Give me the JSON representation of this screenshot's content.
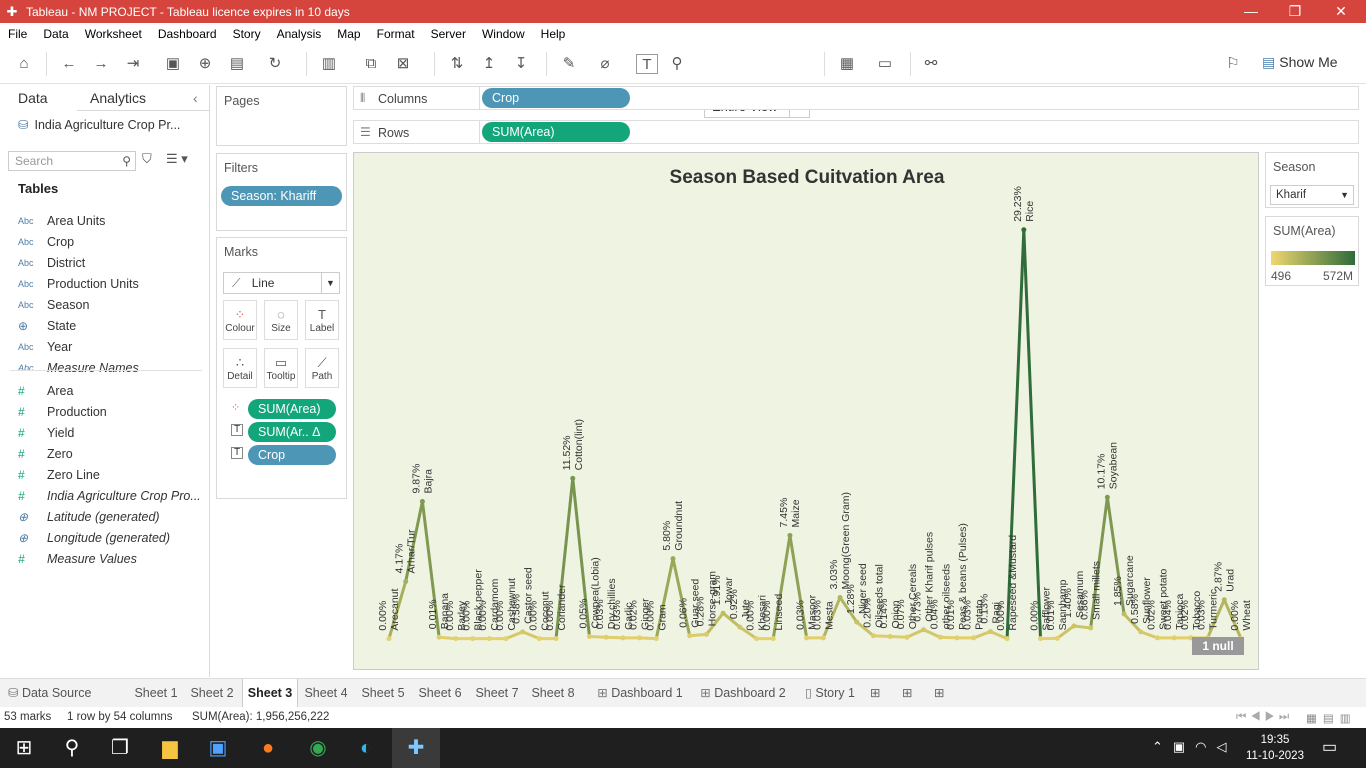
{
  "window": {
    "title": "Tableau - NM PROJECT - Tableau licence expires in 10 days"
  },
  "menu": [
    "File",
    "Data",
    "Worksheet",
    "Dashboard",
    "Story",
    "Analysis",
    "Map",
    "Format",
    "Server",
    "Window",
    "Help"
  ],
  "toolbar": {
    "fit": "Entire View",
    "show_me": "Show Me"
  },
  "left": {
    "tab_data": "Data",
    "tab_analytics": "Analytics",
    "datasource": "India Agriculture Crop Pr...",
    "search_placeholder": "Search",
    "tables_heading": "Tables",
    "fields": [
      {
        "type": "Abc",
        "name": "Area Units"
      },
      {
        "type": "Abc",
        "name": "Crop"
      },
      {
        "type": "Abc",
        "name": "District"
      },
      {
        "type": "Abc",
        "name": "Production Units"
      },
      {
        "type": "Abc",
        "name": "Season"
      },
      {
        "type": "geo",
        "name": "State"
      },
      {
        "type": "Abc",
        "name": "Year"
      },
      {
        "type": "Abc",
        "name": "Measure Names"
      },
      {
        "type": "#",
        "name": "Area"
      },
      {
        "type": "#",
        "name": "Production"
      },
      {
        "type": "#",
        "name": "Yield"
      },
      {
        "type": "#",
        "name": "Zero"
      },
      {
        "type": "#",
        "name": "Zero Line"
      },
      {
        "type": "#",
        "name": "India Agriculture Crop Pro..."
      },
      {
        "type": "geo",
        "name": "Latitude (generated)"
      },
      {
        "type": "geo",
        "name": "Longitude (generated)"
      },
      {
        "type": "#",
        "name": "Measure Values"
      }
    ]
  },
  "cards": {
    "pages": "Pages",
    "filters": "Filters",
    "filter_pill": "Season: Khariff",
    "marks": "Marks",
    "mark_type": "Line",
    "mark_buttons": [
      "Colour",
      "Size",
      "Label",
      "Detail",
      "Tooltip",
      "Path"
    ],
    "mark_pills": [
      "SUM(Area)",
      "SUM(Ar.. Δ",
      "Crop"
    ]
  },
  "shelves": {
    "columns_label": "Columns",
    "columns_pill": "Crop",
    "rows_label": "Rows",
    "rows_pill": "SUM(Area)"
  },
  "legend": {
    "season_title": "Season",
    "season_value": "Kharif",
    "color_title": "SUM(Area)",
    "min": "496",
    "max": "572M",
    "color_low": "#f0d770",
    "color_high": "#2e6b3a"
  },
  "null_badge": "1 null",
  "chart_data": {
    "type": "line",
    "title": "Season Based Cuitvation Area",
    "xlabel": "",
    "ylabel": "",
    "ylim": [
      0,
      30
    ],
    "grid": false,
    "points": [
      {
        "crop": "Arecanut",
        "pct": "0.00%",
        "v": 0.1
      },
      {
        "crop": "Arhar/Tur",
        "pct": "4.17%",
        "v": 4.17
      },
      {
        "crop": "Bajra",
        "pct": "9.87%",
        "v": 9.87
      },
      {
        "crop": "Banana",
        "pct": "0.01%",
        "v": 0.2
      },
      {
        "crop": "Barley",
        "pct": "0.00%",
        "v": 0.1
      },
      {
        "crop": "Black pepper",
        "pct": "0.00%",
        "v": 0.1
      },
      {
        "crop": "Cardamom",
        "pct": "0.00%",
        "v": 0.1
      },
      {
        "crop": "Cashewnut",
        "pct": "0.00%",
        "v": 0.1
      },
      {
        "crop": "Castor seed",
        "pct": "0.58%",
        "v": 0.58
      },
      {
        "crop": "Coconut",
        "pct": "0.00%",
        "v": 0.1
      },
      {
        "crop": "Coriander",
        "pct": "0.00%",
        "v": 0.1
      },
      {
        "crop": "Cotton(lint)",
        "pct": "11.52%",
        "v": 11.52
      },
      {
        "crop": "Cowpea(Lobia)",
        "pct": "0.05%",
        "v": 0.25
      },
      {
        "crop": "Dry chillies",
        "pct": "0.03%",
        "v": 0.2
      },
      {
        "crop": "Garlic",
        "pct": "0.03%",
        "v": 0.15
      },
      {
        "crop": "Ginger",
        "pct": "0.02%",
        "v": 0.15
      },
      {
        "crop": "Gram",
        "pct": "0.00%",
        "v": 0.1
      },
      {
        "crop": "Groundnut",
        "pct": "5.80%",
        "v": 5.8
      },
      {
        "crop": "Guar seed",
        "pct": "0.06%",
        "v": 0.3
      },
      {
        "crop": "Horse-gram",
        "pct": "0.28%",
        "v": 0.4
      },
      {
        "crop": "Jowar",
        "pct": "1.91%",
        "v": 1.91
      },
      {
        "crop": "Jute",
        "pct": "0.92%",
        "v": 0.92
      },
      {
        "crop": "Khesari",
        "pct": "0.00%",
        "v": 0.1
      },
      {
        "crop": "Linseed",
        "pct": "0.00%",
        "v": 0.1
      },
      {
        "crop": "Maize",
        "pct": "7.45%",
        "v": 7.45
      },
      {
        "crop": "Masoor",
        "pct": "0.03%",
        "v": 0.15
      },
      {
        "crop": "Mesta",
        "pct": "0.03%",
        "v": 0.15
      },
      {
        "crop": "Moong(Green Gram)",
        "pct": "3.03%",
        "v": 3.03
      },
      {
        "crop": "Niger seed",
        "pct": "1.28%",
        "v": 1.28
      },
      {
        "crop": "Oilseeds total",
        "pct": "0.20%",
        "v": 0.3
      },
      {
        "crop": "Onion",
        "pct": "0.14%",
        "v": 0.25
      },
      {
        "crop": "Other Cereals",
        "pct": "0.07%",
        "v": 0.2
      },
      {
        "crop": "Other Kharif pulses",
        "pct": "0.73%",
        "v": 0.73
      },
      {
        "crop": "other oilseeds",
        "pct": "0.04%",
        "v": 0.2
      },
      {
        "crop": "Peas & beans (Pulses)",
        "pct": "0.01%",
        "v": 0.15
      },
      {
        "crop": "Potato",
        "pct": "0.03%",
        "v": 0.15
      },
      {
        "crop": "Ragi",
        "pct": "0.13%",
        "v": 0.6
      },
      {
        "crop": "Rapeseed &Mustard",
        "pct": "0.00%",
        "v": 0.1
      },
      {
        "crop": "Rice",
        "pct": "29.23%",
        "v": 29.23
      },
      {
        "crop": "Safflower",
        "pct": "0.00%",
        "v": 0.1
      },
      {
        "crop": "Sannhamp",
        "pct": "0.01%",
        "v": 0.12
      },
      {
        "crop": "Sesamum",
        "pct": "1.40%",
        "v": 1.0
      },
      {
        "crop": "Small millets",
        "pct": "0.86%",
        "v": 0.86
      },
      {
        "crop": "Soyabean",
        "pct": "10.17%",
        "v": 10.17
      },
      {
        "crop": "Sugarcane",
        "pct": "1.85%",
        "v": 1.85
      },
      {
        "crop": "Sunflower",
        "pct": "0.58%",
        "v": 0.58
      },
      {
        "crop": "Sweet potato",
        "pct": "0.02%",
        "v": 0.15
      },
      {
        "crop": "Tapioca",
        "pct": "0.04%",
        "v": 0.15
      },
      {
        "crop": "Tobacco",
        "pct": "0.02%",
        "v": 0.15
      },
      {
        "crop": "Turmeric",
        "pct": "0.03%",
        "v": 0.15
      },
      {
        "crop": "Urad",
        "pct": "2.87%",
        "v": 2.87
      },
      {
        "crop": "Wheat",
        "pct": "0.00%",
        "v": 0.1
      }
    ]
  },
  "sheets": [
    "Data Source",
    "Sheet 1",
    "Sheet 2",
    "Sheet 3",
    "Sheet 4",
    "Sheet 5",
    "Sheet 6",
    "Sheet 7",
    "Sheet 8",
    "Dashboard 1",
    "Dashboard 2",
    "Story 1"
  ],
  "status": {
    "marks": "53 marks",
    "dims": "1 row by 54 columns",
    "sum": "SUM(Area): 1,956,256,222"
  },
  "taskbar": {
    "time": "19:35",
    "date": "11-10-2023"
  }
}
